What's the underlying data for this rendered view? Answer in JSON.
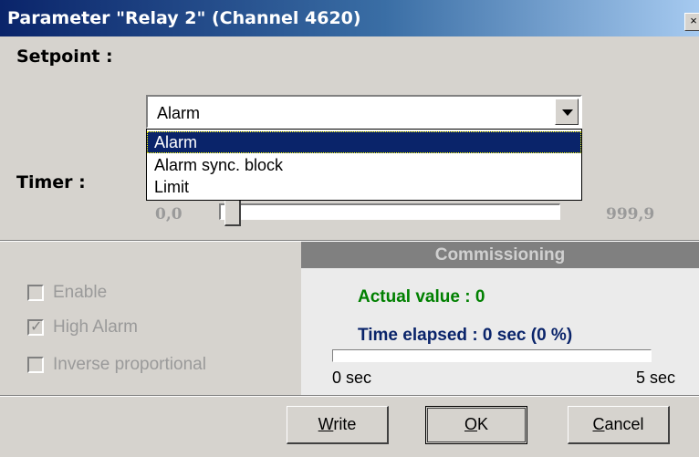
{
  "window": {
    "title": "Parameter \"Relay 2\" (Channel 4620)",
    "close_label": "×"
  },
  "setpoint": {
    "label": "Setpoint :",
    "selected": "Alarm",
    "options": [
      "Alarm",
      "Alarm sync. block",
      "Limit"
    ],
    "highlighted_option": "Alarm"
  },
  "timer": {
    "label": "Timer :",
    "min_label": "0,0",
    "max_label": "999,9",
    "value": 0.0
  },
  "options": {
    "enable": {
      "label": "Enable",
      "checked": false
    },
    "high_alarm": {
      "label": "High Alarm",
      "checked": true
    },
    "inverse": {
      "label": "Inverse proportional",
      "checked": false
    }
  },
  "commissioning": {
    "title": "Commissioning",
    "actual_value": "Actual value : 0",
    "time_elapsed": "Time elapsed : 0 sec (0 %)",
    "progress_fraction": 0,
    "min_label": "0 sec",
    "max_label": "5 sec"
  },
  "buttons": {
    "write": {
      "first": "W",
      "rest": "rite"
    },
    "ok": {
      "first": "O",
      "rest": "K"
    },
    "cancel": {
      "first": "C",
      "rest": "ancel"
    }
  },
  "colors": {
    "title_bar": "#0a246a",
    "selection": "#0a246a",
    "actual_value": "#008000",
    "time_elapsed": "#0a246a",
    "disabled_text": "#9a9a9a"
  }
}
